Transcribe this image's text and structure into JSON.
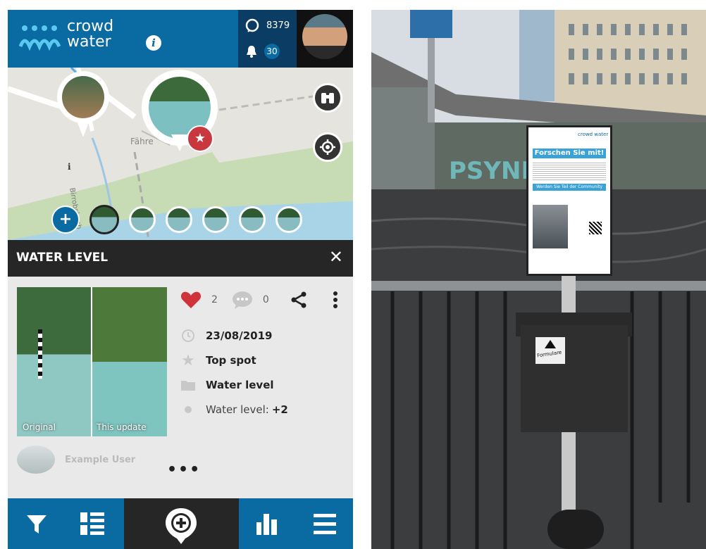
{
  "colors": {
    "brand_blue": "#0a6aa2",
    "dark_navy": "#0b3c63",
    "dark_bar": "#262626",
    "heart_red": "#d0323a",
    "star_badge": "#c9383f"
  },
  "header": {
    "logo_line1": "crowd",
    "logo_line2": "water",
    "points": "8379",
    "notifications": "30"
  },
  "map": {
    "street_label": "Fähre",
    "vertical_label": "Birrobsbach"
  },
  "panel": {
    "title": "WATER LEVEL"
  },
  "photo": {
    "left_label": "Original",
    "right_label": "This update"
  },
  "actions": {
    "likes": "2",
    "comments": "0"
  },
  "details": {
    "date": "23/08/2019",
    "spot": "Top spot",
    "category": "Water level",
    "level_label": "Water level: ",
    "level_value": "+2"
  },
  "user": {
    "name": "Example User"
  },
  "more": "•••",
  "sign": {
    "heading": "Forschen Sie mit!",
    "subheading": "Werden Sie Teil der Community",
    "logo": "crowd water",
    "box_label": "Formulare"
  },
  "icons": [
    "info-icon",
    "checkmark-icon",
    "bell-icon",
    "binoculars-icon",
    "locate-icon",
    "add-icon",
    "star-icon",
    "close-icon",
    "heart-icon",
    "comment-icon",
    "share-icon",
    "kebab-icon",
    "clock-icon",
    "folder-icon",
    "dot-icon",
    "filter-icon",
    "list-icon",
    "add-location-icon",
    "chart-icon",
    "menu-icon"
  ]
}
